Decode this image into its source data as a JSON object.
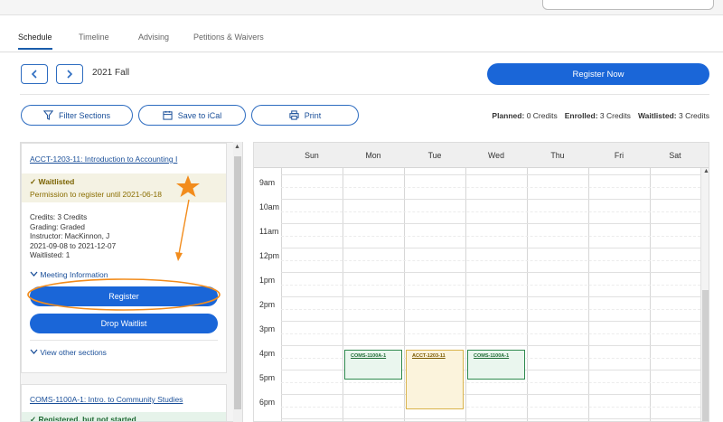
{
  "tabs": [
    {
      "label": "Schedule",
      "active": true
    },
    {
      "label": "Timeline"
    },
    {
      "label": "Advising"
    },
    {
      "label": "Petitions & Waivers"
    }
  ],
  "term": {
    "label": "2021 Fall",
    "prev_icon": "chevron-left-icon",
    "next_icon": "chevron-right-icon"
  },
  "toolbar": {
    "register_now": "Register Now",
    "filter_sections": "Filter Sections",
    "save_to_ical": "Save to iCal",
    "print": "Print"
  },
  "credits": {
    "planned_label": "Planned:",
    "planned_value": "0 Credits",
    "enrolled_label": "Enrolled:",
    "enrolled_value": "3 Credits",
    "waitlisted_label": "Waitlisted:",
    "waitlisted_value": "3 Credits"
  },
  "course1": {
    "title": "ACCT-1203-11: Introduction to Accounting I",
    "status": "Waitlisted",
    "status_note": "Permission to register until 2021-06-18",
    "credits": "Credits: 3 Credits",
    "grading": "Grading: Graded",
    "instructor": "Instructor: MacKinnon, J",
    "dates": "2021-09-08 to 2021-12-07",
    "waitlisted": "Waitlisted:  1",
    "meeting_info": "Meeting Information",
    "register_btn": "Register",
    "drop_btn": "Drop Waitlist",
    "other_sections": "View other sections"
  },
  "course2": {
    "title": "COMS-1100A-1: Intro. to Community Studies",
    "status": "Registered, but not started"
  },
  "calendar": {
    "days": [
      "Sun",
      "Mon",
      "Tue",
      "Wed",
      "Thu",
      "Fri",
      "Sat"
    ],
    "hours": [
      "9am",
      "10am",
      "11am",
      "12pm",
      "1pm",
      "2pm",
      "3pm",
      "4pm",
      "5pm",
      "6pm"
    ],
    "events": [
      {
        "label": "COMS-1100A-1",
        "day": "Mon",
        "status": "enrolled"
      },
      {
        "label": "ACCT-1203-11",
        "day": "Tue",
        "status": "waitlisted"
      },
      {
        "label": "COMS-1100A-1",
        "day": "Wed",
        "status": "enrolled"
      }
    ]
  },
  "annotation": {
    "color": "#f28c1c",
    "icon": "star-icon"
  },
  "colors": {
    "primary": "#1a66d8",
    "link": "#1a4f99",
    "waitlisted_bg": "#f4f2e3",
    "enrolled_bg": "#eaf6ee"
  }
}
